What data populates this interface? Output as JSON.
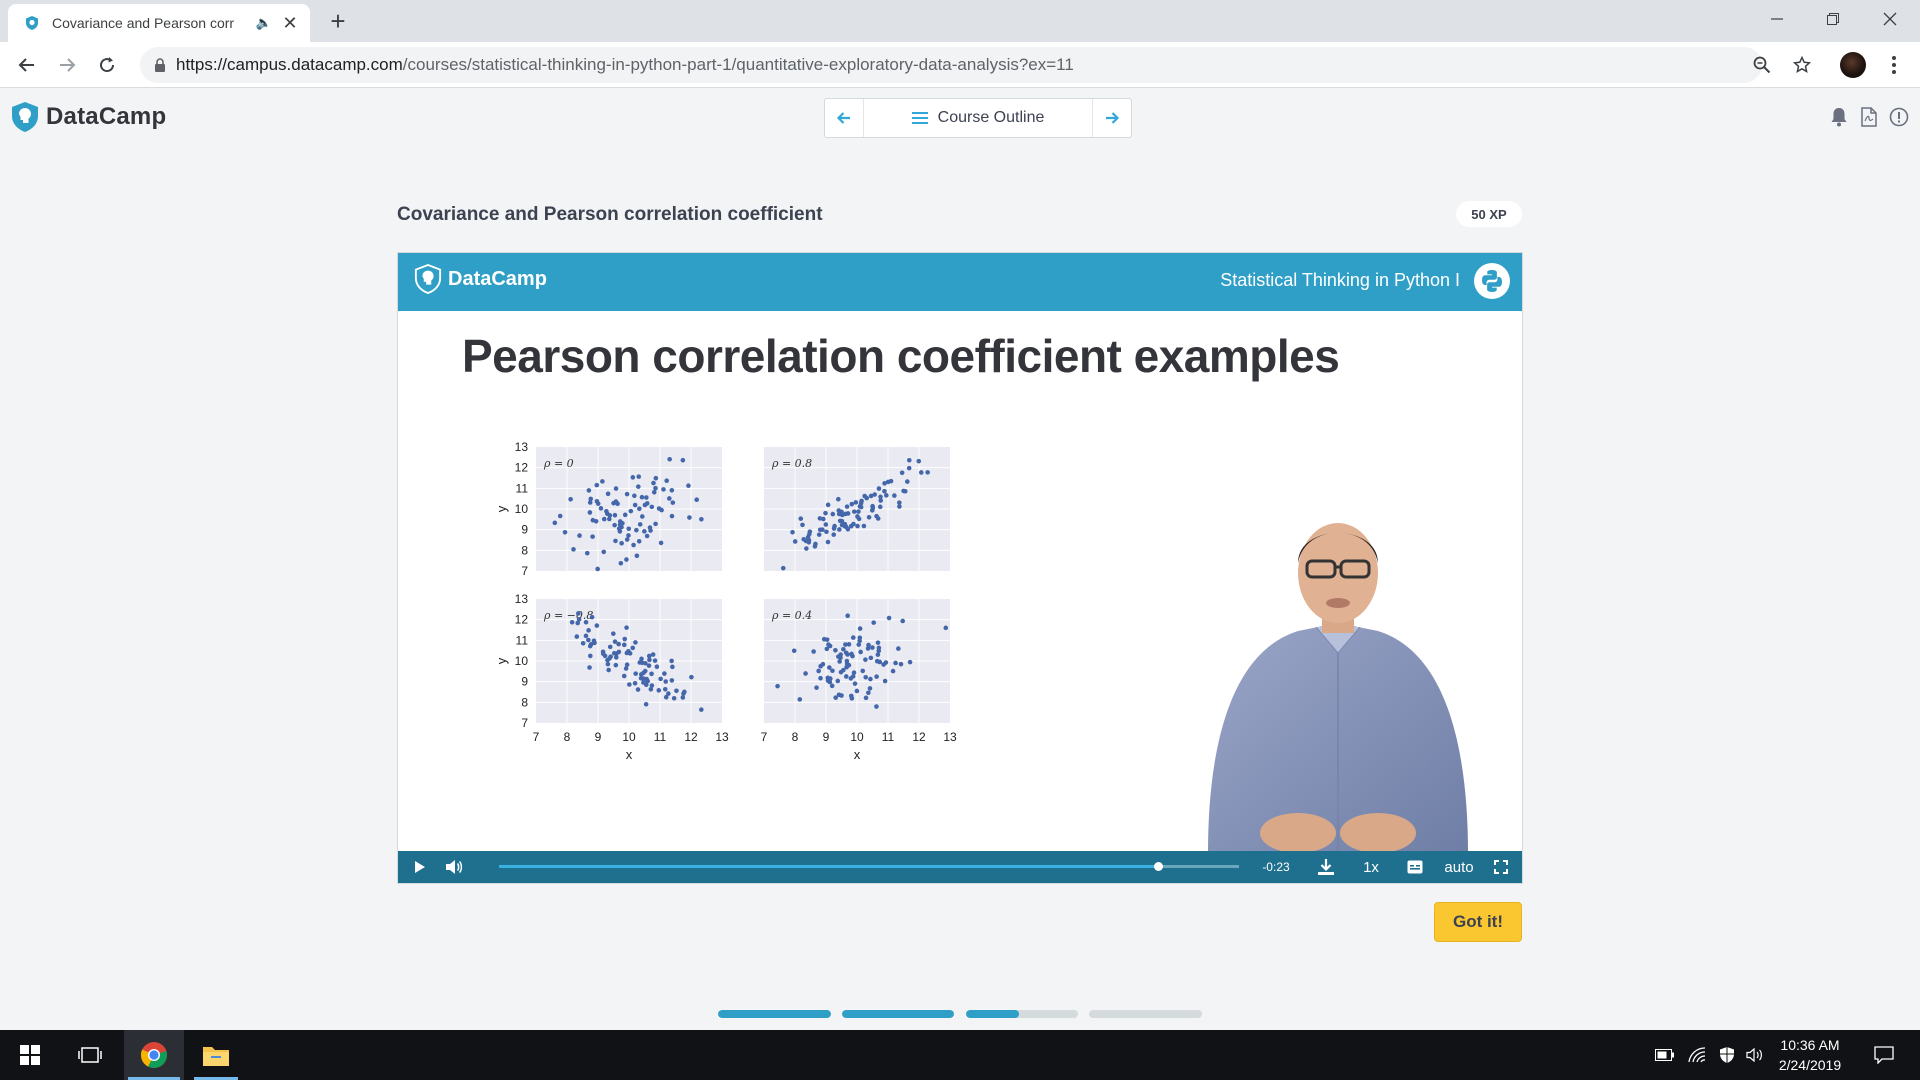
{
  "browser": {
    "tab_title": "Covariance and Pearson corr",
    "new_tab_label": "+",
    "url_host": "https://campus.datacamp.com",
    "url_path": "/courses/statistical-thinking-in-python-part-1/quantitative-exploratory-data-analysis?ex=11",
    "icons": [
      "back-icon",
      "forward-icon",
      "reload-icon",
      "lock-icon",
      "zoom-icon",
      "star-icon",
      "profile-avatar",
      "menu-icon",
      "minimize-icon",
      "restore-icon",
      "close-icon",
      "audio-icon"
    ]
  },
  "header": {
    "logo_text": "DataCamp",
    "course_outline_label": "Course Outline",
    "brand_color": "#2f9fc7"
  },
  "exercise": {
    "title": "Covariance and Pearson correlation coefficient",
    "xp": "50 XP",
    "got_it_label": "Got it!",
    "progress": [
      1.0,
      1.0,
      0.47,
      0.0
    ]
  },
  "video": {
    "banner_logo": "DataCamp",
    "banner_course": "Statistical Thinking in Python I",
    "slide_title": "Pearson correlation coefficient examples",
    "time_remaining": "-0:23",
    "speed": "1x",
    "quality": "auto",
    "playback_progress": 0.89
  },
  "chart_data": {
    "type": "scatter",
    "xlabel": "x",
    "ylabel": "y",
    "xlim": [
      7,
      13
    ],
    "ylim": [
      7,
      13
    ],
    "xticks": [
      "7",
      "8",
      "9",
      "10",
      "11",
      "12",
      "13"
    ],
    "yticks": [
      "7",
      "8",
      "9",
      "10",
      "11",
      "12",
      "13"
    ],
    "panels": [
      {
        "label": "ρ = 0",
        "rho": 0.0
      },
      {
        "label": "ρ = 0.8",
        "rho": 0.8
      },
      {
        "label": "ρ = −0.8",
        "rho": -0.8
      },
      {
        "label": "ρ = 0.4",
        "rho": 0.4
      }
    ],
    "point_color": "#4466aa",
    "panel_bg": "#eaeaf2"
  },
  "taskbar": {
    "time": "10:36 AM",
    "date": "2/24/2019"
  }
}
